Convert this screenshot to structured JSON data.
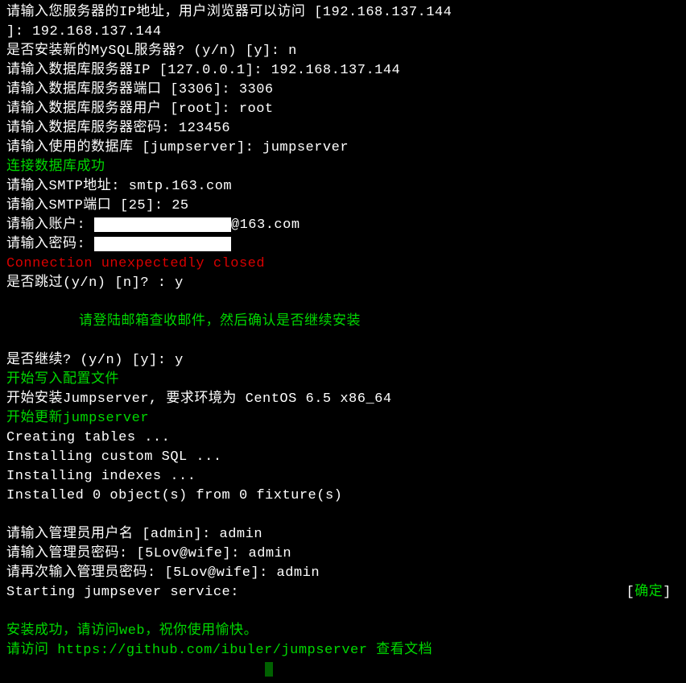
{
  "l01": "请输入您服务器的IP地址，用户浏览器可以访问 [192.168.137.144",
  "l02": "]: 192.168.137.144",
  "l03": "是否安装新的MySQL服务器? (y/n) [y]: n",
  "l04": "请输入数据库服务器IP [127.0.0.1]: 192.168.137.144",
  "l05": "请输入数据库服务器端口 [3306]: 3306",
  "l06": "请输入数据库服务器用户 [root]: root",
  "l07": "请输入数据库服务器密码: 123456",
  "l08": "请输入使用的数据库 [jumpserver]: jumpserver",
  "l09": "连接数据库成功",
  "l10": "请输入SMTP地址: smtp.163.com",
  "l11": "请输入SMTP端口 [25]: 25",
  "l12a": "请输入账户: ",
  "l12b": "@163.com",
  "l13": "请输入密码: ",
  "l14": "Connection unexpectedly closed",
  "l15": "是否跳过(y/n) [n]? : y",
  "l17": "请登陆邮箱查收邮件，然后确认是否继续安装",
  "l19": "是否继续? (y/n) [y]: y",
  "l20": "开始写入配置文件",
  "l21": "开始安装Jumpserver, 要求环境为 CentOS 6.5 x86_64",
  "l22": "开始更新jumpserver",
  "l23": "Creating tables ...",
  "l24": "Installing custom SQL ...",
  "l25": "Installing indexes ...",
  "l26": "Installed 0 object(s) from 0 fixture(s)",
  "l28": "请输入管理员用户名 [admin]: admin",
  "l29": "请输入管理员密码: [5Lov@wife]: admin",
  "l30": "请再次输入管理员密码: [5Lov@wife]: admin",
  "l31a": "Starting jumpsever service:",
  "l31b_open": "[",
  "l31b_ok": "确定",
  "l31b_close": "]",
  "l33": "安装成功，请访问web，祝你使用愉快。",
  "l34": "请访问 https://github.com/ibuler/jumpserver 查看文档"
}
